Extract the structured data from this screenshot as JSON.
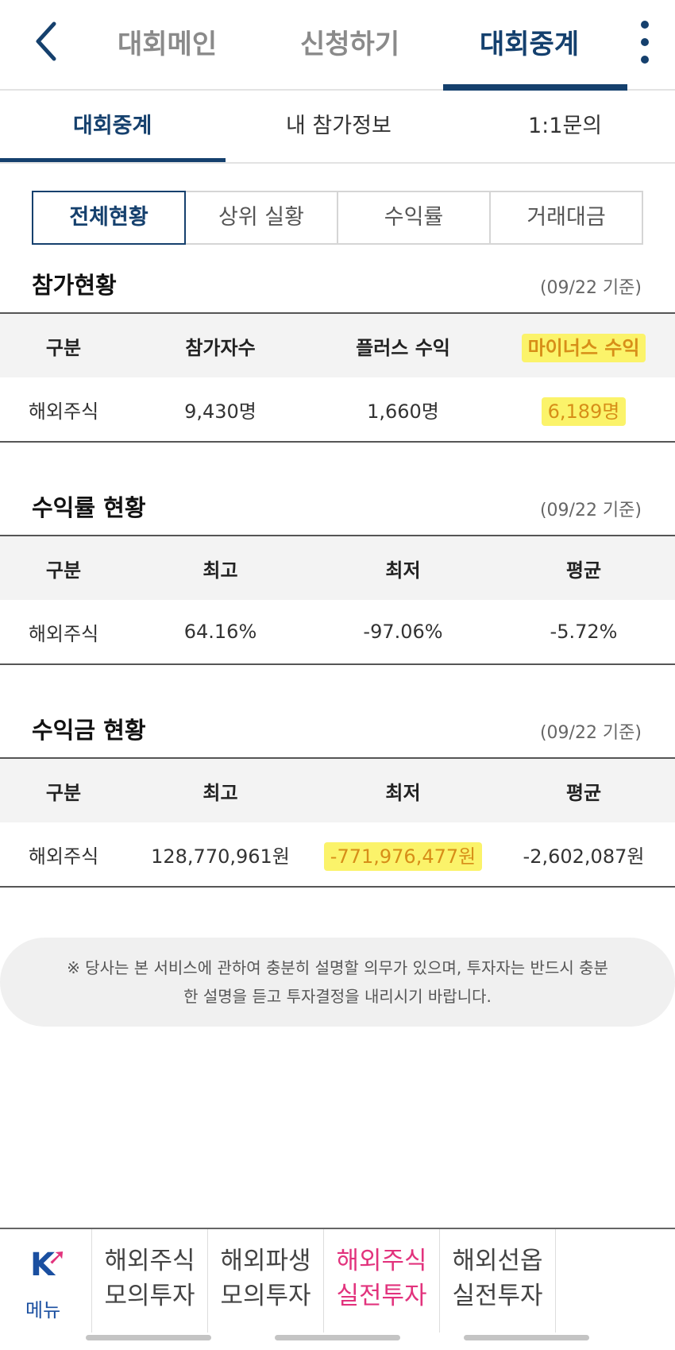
{
  "top_nav": {
    "tabs": [
      "대회메인",
      "신청하기",
      "대회중계"
    ],
    "active_index": 2
  },
  "sub_nav": {
    "tabs": [
      "대회중계",
      "내 참가정보",
      "1:1문의"
    ],
    "active_index": 0
  },
  "segments": {
    "items": [
      "전체현황",
      "상위 실황",
      "수익률",
      "거래대금"
    ],
    "active_index": 0
  },
  "participation": {
    "title": "참가현황",
    "date": "(09/22 기준)",
    "headers": [
      "구분",
      "참가자수",
      "플러스 수익",
      "마이너스 수익"
    ],
    "row": [
      "해외주식",
      "9,430명",
      "1,660명",
      "6,189명"
    ]
  },
  "return_rate": {
    "title": "수익률 현황",
    "date": "(09/22 기준)",
    "headers": [
      "구분",
      "최고",
      "최저",
      "평균"
    ],
    "row": [
      "해외주식",
      "64.16%",
      "-97.06%",
      "-5.72%"
    ]
  },
  "profit": {
    "title": "수익금 현황",
    "date": "(09/22 기준)",
    "headers": [
      "구분",
      "최고",
      "최저",
      "평균"
    ],
    "row": [
      "해외주식",
      "128,770,961원",
      "-771,976,477원",
      "-2,602,087원"
    ]
  },
  "notice": {
    "line1": "※ 당사는 본 서비스에 관하여 충분히 설명할 의무가 있으며, 투자자는 반드시 충분",
    "line2": "한 설명을 듣고 투자결정을 내리시기 바랍니다."
  },
  "bottom_bar": {
    "menu_label": "메뉴",
    "logo_letter": "K",
    "items": [
      {
        "line1": "해외주식",
        "line2": "모의투자"
      },
      {
        "line1": "해외파생",
        "line2": "모의투자"
      },
      {
        "line1": "해외주식",
        "line2": "실전투자"
      },
      {
        "line1": "해외선옵",
        "line2": "실전투자"
      }
    ],
    "highlight_index": 2
  },
  "colors": {
    "primary": "#15406d",
    "highlight": "#fbf36a",
    "accent_pink": "#e2337d"
  }
}
